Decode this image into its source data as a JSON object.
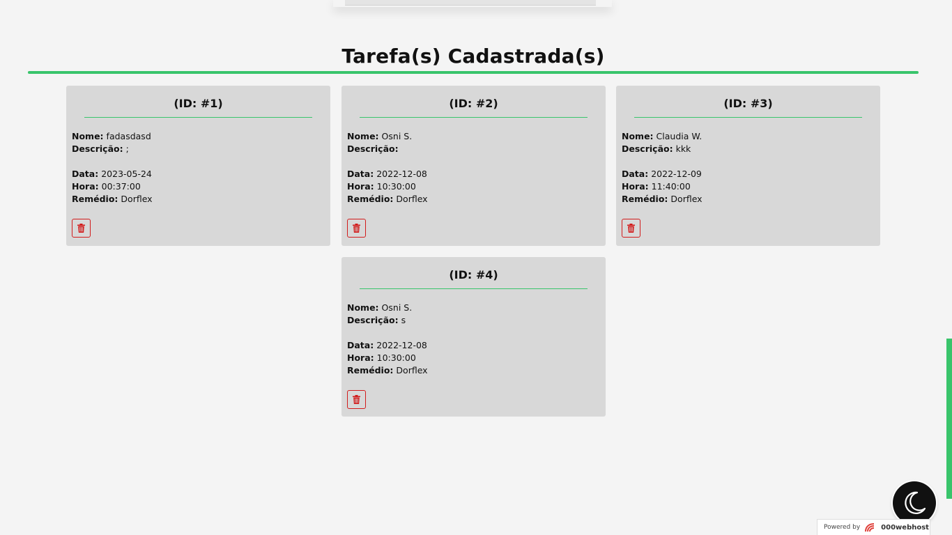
{
  "section": {
    "title": "Tarefa(s) Cadastrada(s)"
  },
  "labels": {
    "nome": "Nome:",
    "descricao": "Descrição:",
    "data": "Data:",
    "hora": "Hora:",
    "remedio": "Remédio:"
  },
  "cards": [
    {
      "id": "(ID: #1)",
      "nome": "fadasdasd",
      "descricao": ";",
      "data": "2023-05-24",
      "hora": "00:37:00",
      "remedio": "Dorflex"
    },
    {
      "id": "(ID: #2)",
      "nome": "Osni S.",
      "descricao": "",
      "data": "2022-12-08",
      "hora": "10:30:00",
      "remedio": "Dorflex"
    },
    {
      "id": "(ID: #3)",
      "nome": "Claudia W.",
      "descricao": "kkk",
      "data": "2022-12-09",
      "hora": "11:40:00",
      "remedio": "Dorflex"
    },
    {
      "id": "(ID: #4)",
      "nome": "Osni S.",
      "descricao": "s",
      "data": "2022-12-08",
      "hora": "10:30:00",
      "remedio": "Dorflex"
    }
  ],
  "icons": {
    "delete": "trash-icon",
    "theme_toggle": "moon-icon",
    "host_logo": "000webhost-logo-icon"
  },
  "footer": {
    "powered_by": "Powered by",
    "brand": "000webhost"
  },
  "colors": {
    "accent": "#39c46b",
    "delete": "#d21b1b",
    "card_bg": "#d8d8d8",
    "page_bg": "#f4f4f4"
  }
}
